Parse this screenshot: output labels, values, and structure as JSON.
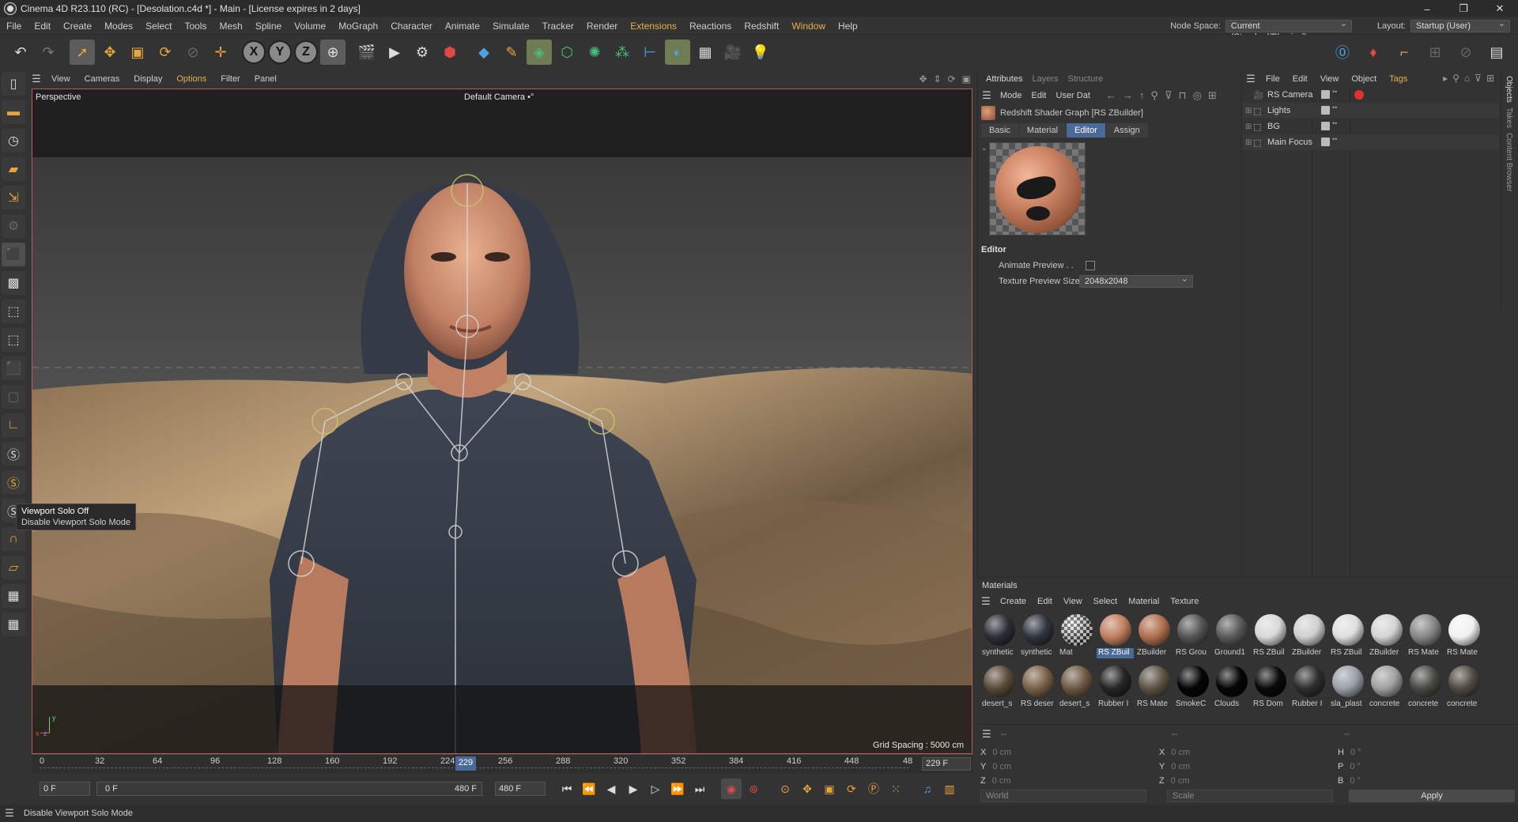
{
  "window": {
    "title": "Cinema 4D R23.110 (RC) - [Desolation.c4d *] - Main - [License expires in 2 days]",
    "controls": [
      "–",
      "❐",
      "✕"
    ]
  },
  "menu": {
    "items": [
      "File",
      "Edit",
      "Create",
      "Modes",
      "Select",
      "Tools",
      "Mesh",
      "Spline",
      "Volume",
      "MoGraph",
      "Character",
      "Animate",
      "Simulate",
      "Tracker",
      "Render",
      "Extensions",
      "Reactions",
      "Redshift",
      "Window",
      "Help"
    ],
    "node_space_label": "Node Space:",
    "node_space_value": "Current (Standard/Physical)",
    "layout_label": "Layout:",
    "layout_value": "Startup (User)"
  },
  "viewport": {
    "menu": [
      "View",
      "Cameras",
      "Display",
      "Options",
      "Filter",
      "Panel"
    ],
    "view_name": "Perspective",
    "camera": "Default Camera",
    "camera_suffix": "•°",
    "grid_spacing": "Grid Spacing : 5000 cm",
    "axis_y": "y",
    "axis_x": "x",
    "axis_z": "z"
  },
  "tooltip": {
    "title": "Viewport Solo Off",
    "desc": "Disable Viewport Solo Mode"
  },
  "timeline": {
    "ticks": [
      "0",
      "32",
      "64",
      "96",
      "128",
      "160",
      "192",
      "224",
      "256",
      "288",
      "320",
      "352",
      "384",
      "416",
      "448",
      "48"
    ],
    "current_frame": "229",
    "end_frame_field": "229 F"
  },
  "transport": {
    "start_field": "0 F",
    "slider_start": "0 F",
    "slider_end": "480 F",
    "end_field": "480 F"
  },
  "status": {
    "text": "Disable Viewport Solo Mode"
  },
  "attributes": {
    "tabs": [
      "Attributes",
      "Layers",
      "Structure"
    ],
    "menu": [
      "Mode",
      "Edit",
      "User Dat"
    ],
    "shader_title": "Redshift Shader Graph [RS ZBuilder]",
    "subtabs": [
      "Basic",
      "Material",
      "Editor",
      "Assign"
    ],
    "section": "Editor",
    "animate_preview_label": "Animate Preview . .",
    "texture_size_label": "Texture Preview Size",
    "texture_size_value": "2048x2048"
  },
  "objects": {
    "menu": [
      "File",
      "Edit",
      "View",
      "Object",
      "Tags"
    ],
    "items": [
      {
        "name": "RS Camera",
        "icon": "camera-icon"
      },
      {
        "name": "Lights",
        "icon": "light-icon"
      },
      {
        "name": "BG",
        "icon": "background-icon"
      },
      {
        "name": "Main Focus",
        "icon": "focus-icon"
      }
    ],
    "side_tabs": [
      "Objects",
      "Takes",
      "Content Browser"
    ]
  },
  "materials": {
    "title": "Materials",
    "menu": [
      "Create",
      "Edit",
      "View",
      "Select",
      "Material",
      "Texture"
    ],
    "items": [
      {
        "name": "synthetic",
        "color": "#2b2f36"
      },
      {
        "name": "synthetic",
        "color": "#30353e"
      },
      {
        "name": "Mat",
        "color": "checker"
      },
      {
        "name": "RS ZBuil",
        "color": "#c08060"
      },
      {
        "name": "ZBuilder",
        "color": "#b07050"
      },
      {
        "name": "RS Grou",
        "color": "#555555"
      },
      {
        "name": "Ground1",
        "color": "#5a5a5a"
      },
      {
        "name": "RS ZBuil",
        "color": "#d8d8d8"
      },
      {
        "name": "ZBuilder",
        "color": "#cfcfcf"
      },
      {
        "name": "RS ZBuil",
        "color": "#dedede"
      },
      {
        "name": "ZBuilder",
        "color": "#d4d4d4"
      },
      {
        "name": "RS Mate",
        "color": "#888888"
      },
      {
        "name": "RS Mate",
        "color": "#f2f2f2"
      },
      {
        "name": "desert_s",
        "color": "#5a4a38"
      },
      {
        "name": "RS deser",
        "color": "#7a6248"
      },
      {
        "name": "desert_s",
        "color": "#6e5a44"
      },
      {
        "name": "Rubber I",
        "color": "#262626"
      },
      {
        "name": "RS Mate",
        "color": "#5e5346"
      },
      {
        "name": "SmokeC",
        "color": "#050505"
      },
      {
        "name": "Clouds",
        "color": "#050505"
      },
      {
        "name": "RS Dom",
        "color": "#0a0a0a"
      },
      {
        "name": "Rubber I",
        "color": "#2e2e2e"
      },
      {
        "name": "sla_plast",
        "color": "#9aa0a8"
      },
      {
        "name": "concrete",
        "color": "#a0a0a0"
      },
      {
        "name": "concrete",
        "color": "#4a4a44"
      },
      {
        "name": "concrete",
        "color": "#4f4b42"
      }
    ],
    "selected_index": 3
  },
  "coordinates": {
    "dash": "--",
    "rows": [
      {
        "a": "X",
        "av": "0 cm",
        "b": "X",
        "bv": "0 cm",
        "c": "H",
        "cv": "0 °"
      },
      {
        "a": "Y",
        "av": "0 cm",
        "b": "Y",
        "bv": "0 cm",
        "c": "P",
        "cv": "0 °"
      },
      {
        "a": "Z",
        "av": "0 cm",
        "b": "Z",
        "bv": "0 cm",
        "c": "B",
        "cv": "0 °"
      }
    ],
    "mode1": "World",
    "mode2": "Scale",
    "apply": "Apply"
  }
}
